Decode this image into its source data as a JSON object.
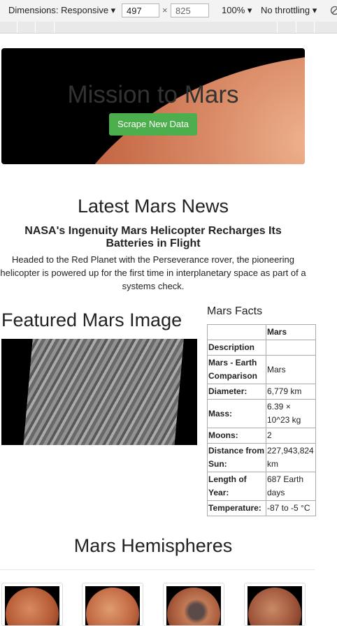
{
  "devtools": {
    "dimensions_label": "Dimensions: Responsive ▾",
    "width_value": "497",
    "times": "×",
    "height_value": "825",
    "zoom_label": "100% ▾",
    "throttling_label": "No throttling ▾"
  },
  "hero": {
    "title": "Mission to Mars",
    "button_label": "Scrape New Data"
  },
  "news": {
    "heading": "Latest Mars News",
    "title": "NASA's Ingenuity Mars Helicopter Recharges Its Batteries in Flight",
    "paragraph": "Headed to the Red Planet with the Perseverance rover, the pioneering helicopter is powered up for the first time in interplanetary space as part of a systems check."
  },
  "featured": {
    "heading": "Featured Mars Image"
  },
  "facts": {
    "heading": "Mars Facts",
    "column_header": "Mars",
    "rows": [
      {
        "key": "Description",
        "value": ""
      },
      {
        "key": "Mars - Earth Comparison",
        "value": "Mars"
      },
      {
        "key": "Diameter:",
        "value": "6,779 km"
      },
      {
        "key": "Mass:",
        "value": "6.39 × 10^23 kg"
      },
      {
        "key": "Moons:",
        "value": "2"
      },
      {
        "key": "Distance from Sun:",
        "value": "227,943,824 km"
      },
      {
        "key": "Length of Year:",
        "value": "687 Earth days"
      },
      {
        "key": "Temperature:",
        "value": "-87 to -5 °C"
      }
    ]
  },
  "hemispheres": {
    "heading": "Mars Hemispheres"
  }
}
